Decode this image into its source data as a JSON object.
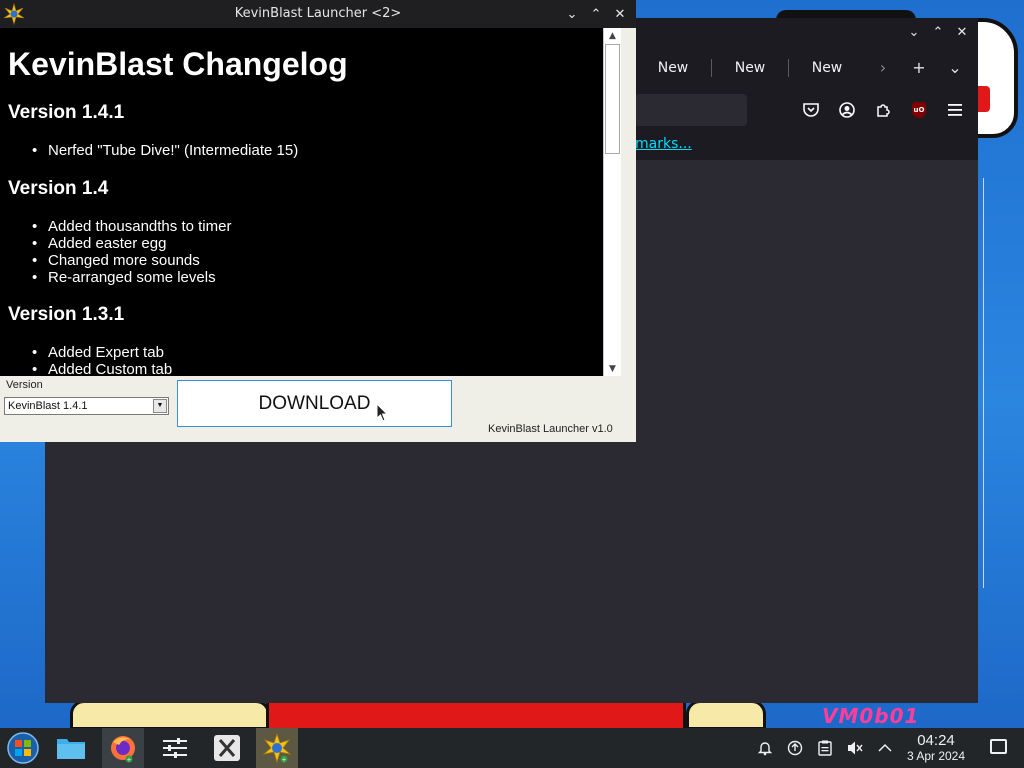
{
  "launcher": {
    "window_title": "KevinBlast Launcher <2>",
    "changelog_title": "KevinBlast Changelog",
    "versions": [
      {
        "title": "Version 1.4.1",
        "items": [
          "Nerfed \"Tube Dive!\" (Intermediate 15)"
        ]
      },
      {
        "title": "Version 1.4",
        "items": [
          "Added thousandths to timer",
          "Added easter egg",
          "Changed more sounds",
          "Re-arranged some levels"
        ]
      },
      {
        "title": "Version 1.3.1",
        "items": [
          "Added Expert tab",
          "Added Custom tab"
        ]
      }
    ],
    "version_label": "Version",
    "version_selected": "KevinBlast 1.4.1",
    "download_label": "DOWNLOAD",
    "footer": "KevinBlast Launcher v1.0"
  },
  "browser": {
    "tabs": [
      "New",
      "New",
      "New"
    ],
    "bookmark_link": "marks..."
  },
  "desktop": {
    "wallpaper_signature": "VM0b01"
  },
  "taskbar": {
    "apps": [
      {
        "name": "start-menu",
        "icon": "windows-orb-icon"
      },
      {
        "name": "file-manager",
        "icon": "folder-icon"
      },
      {
        "name": "firefox",
        "icon": "firefox-icon"
      },
      {
        "name": "mixer",
        "icon": "sliders-icon"
      },
      {
        "name": "x-app",
        "icon": "x-app-icon"
      },
      {
        "name": "kevinblast-launcher",
        "icon": "kevinblast-icon"
      }
    ],
    "time": "04:24",
    "date": "3 Apr 2024"
  },
  "colors": {
    "desktop_blue": "#2a7fd4",
    "browser_dark": "#2b2a33",
    "link_cyan": "#00ddff",
    "taskbar": "#232629"
  }
}
